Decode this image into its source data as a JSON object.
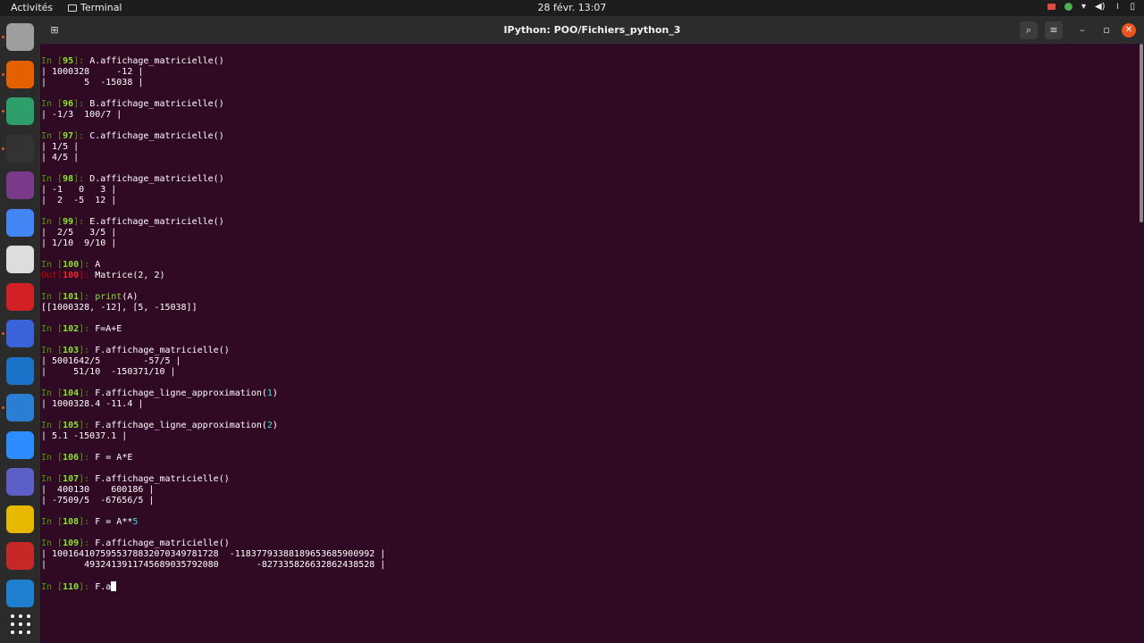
{
  "topbar": {
    "activities": "Activités",
    "app_name": "Terminal",
    "clock": "28 févr.  13:07"
  },
  "dock": {
    "apps": [
      {
        "name": "files",
        "color": "#9e9e9e"
      },
      {
        "name": "firefox",
        "color": "#e66000"
      },
      {
        "name": "atom",
        "color": "#2e9e6a"
      },
      {
        "name": "terminal",
        "color": "#333333"
      },
      {
        "name": "video-editor",
        "color": "#7a3a8a"
      },
      {
        "name": "chrome",
        "color": "#4285f4"
      },
      {
        "name": "document-viewer",
        "color": "#dddddd"
      },
      {
        "name": "opera",
        "color": "#d31f26"
      },
      {
        "name": "screenshot",
        "color": "#3b63d9"
      },
      {
        "name": "writer",
        "color": "#1a73c9"
      },
      {
        "name": "thunderbird",
        "color": "#2a7fd4"
      },
      {
        "name": "zoom",
        "color": "#2d8cff"
      },
      {
        "name": "teams",
        "color": "#5b5fc7"
      },
      {
        "name": "calculator",
        "color": "#e8b800"
      },
      {
        "name": "network-app",
        "color": "#c62828"
      },
      {
        "name": "vscode",
        "color": "#1f7fd1"
      }
    ]
  },
  "window": {
    "title": "IPython: POO/Fichiers_python_3"
  },
  "terminal": {
    "lines": [
      {
        "type": "in",
        "n": "95",
        "code": "A.affichage_matricielle()"
      },
      {
        "type": "text",
        "text": "| 1000328     -12 |"
      },
      {
        "type": "text",
        "text": "|       5  -15038 |"
      },
      {
        "type": "blank"
      },
      {
        "type": "in",
        "n": "96",
        "code": "B.affichage_matricielle()"
      },
      {
        "type": "text",
        "text": "| -1/3  100/7 |"
      },
      {
        "type": "blank"
      },
      {
        "type": "in",
        "n": "97",
        "code": "C.affichage_matricielle()"
      },
      {
        "type": "text",
        "text": "| 1/5 |"
      },
      {
        "type": "text",
        "text": "| 4/5 |"
      },
      {
        "type": "blank"
      },
      {
        "type": "in",
        "n": "98",
        "code": "D.affichage_matricielle()"
      },
      {
        "type": "text",
        "text": "| -1   0   3 |"
      },
      {
        "type": "text",
        "text": "|  2  -5  12 |"
      },
      {
        "type": "blank"
      },
      {
        "type": "in",
        "n": "99",
        "code": "E.affichage_matricielle()"
      },
      {
        "type": "text",
        "text": "|  2/5   3/5 |"
      },
      {
        "type": "text",
        "text": "| 1/10  9/10 |"
      },
      {
        "type": "blank"
      },
      {
        "type": "in",
        "n": "100",
        "code": "A"
      },
      {
        "type": "out",
        "n": "100",
        "code": "Matrice(2, 2)"
      },
      {
        "type": "blank"
      },
      {
        "type": "in",
        "n": "101",
        "code_fn": "print",
        "code": "(A)"
      },
      {
        "type": "text",
        "text": "[[1000328, -12], [5, -15038]]"
      },
      {
        "type": "blank"
      },
      {
        "type": "in",
        "n": "102",
        "code": "F=A+E"
      },
      {
        "type": "blank"
      },
      {
        "type": "in",
        "n": "103",
        "code": "F.affichage_matricielle()"
      },
      {
        "type": "text",
        "text": "| 5001642/5        -57/5 |"
      },
      {
        "type": "text",
        "text": "|     51/10  -150371/10 |"
      },
      {
        "type": "blank"
      },
      {
        "type": "in",
        "n": "104",
        "code": "F.affichage_ligne_approximation(",
        "arg": "1",
        "tail": ")"
      },
      {
        "type": "text",
        "text": "| 1000328.4 -11.4 |"
      },
      {
        "type": "blank"
      },
      {
        "type": "in",
        "n": "105",
        "code": "F.affichage_ligne_approximation(",
        "arg": "2",
        "tail": ")"
      },
      {
        "type": "text",
        "text": "| 5.1 -15037.1 |"
      },
      {
        "type": "blank"
      },
      {
        "type": "in",
        "n": "106",
        "code": "F = A*E"
      },
      {
        "type": "blank"
      },
      {
        "type": "in",
        "n": "107",
        "code": "F.affichage_matricielle()"
      },
      {
        "type": "text",
        "text": "|  400130    600186 |"
      },
      {
        "type": "text",
        "text": "| -7509/5  -67656/5 |"
      },
      {
        "type": "blank"
      },
      {
        "type": "in",
        "n": "108",
        "code": "F = A**",
        "arg": "5",
        "tail": ""
      },
      {
        "type": "blank"
      },
      {
        "type": "in",
        "n": "109",
        "code": "F.affichage_matricielle()"
      },
      {
        "type": "text",
        "text": "| 1001641075955378832070349781728  -1183779338818965368590099​2 |"
      },
      {
        "type": "text",
        "text": "|       4932413911745689035792080       -827335826632862438528 |"
      },
      {
        "type": "blank"
      },
      {
        "type": "in",
        "n": "110",
        "code": "F.a",
        "cursor": true
      }
    ]
  }
}
